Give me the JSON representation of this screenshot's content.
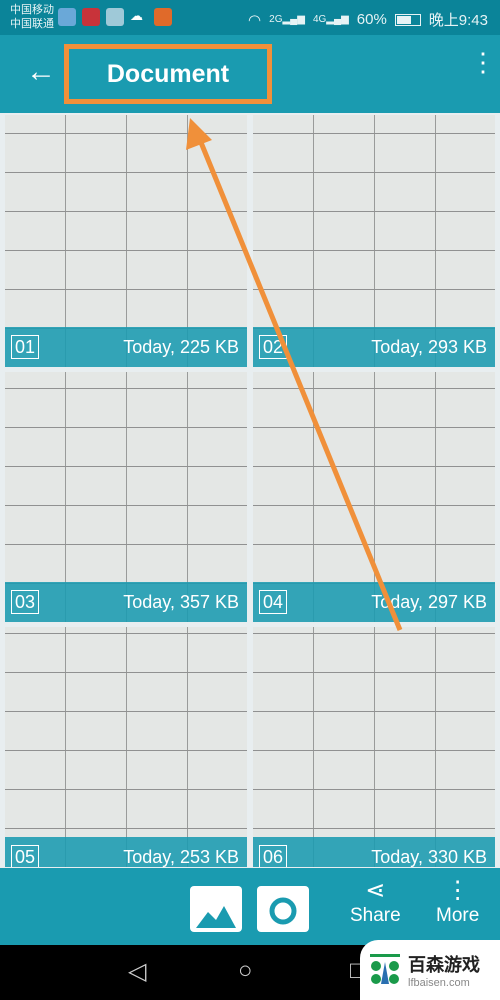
{
  "status_bar": {
    "carrier1": "中国移动",
    "carrier2": "中国联通",
    "network1": "2G",
    "network2": "4G",
    "battery": "60%",
    "battery_level": 0.6,
    "time": "晚上9:43"
  },
  "toolbar": {
    "title": "Document",
    "back_icon": "arrow-left-icon",
    "menu_icon": "more-vert-icon"
  },
  "documents": [
    {
      "index": "01",
      "meta": "Today, 225 KB"
    },
    {
      "index": "02",
      "meta": "Today, 293 KB"
    },
    {
      "index": "03",
      "meta": "Today, 357 KB"
    },
    {
      "index": "04",
      "meta": "Today, 297 KB"
    },
    {
      "index": "05",
      "meta": "Today, 253 KB"
    },
    {
      "index": "06",
      "meta": "Today, 330 KB"
    }
  ],
  "bottom_bar": {
    "share": "Share",
    "more": "More"
  },
  "watermark": {
    "text": "百森游戏",
    "url": "lfbaisen.com"
  },
  "colors": {
    "primary": "#1a9bb0",
    "status": "#0b8499",
    "highlight": "#f0903a"
  }
}
